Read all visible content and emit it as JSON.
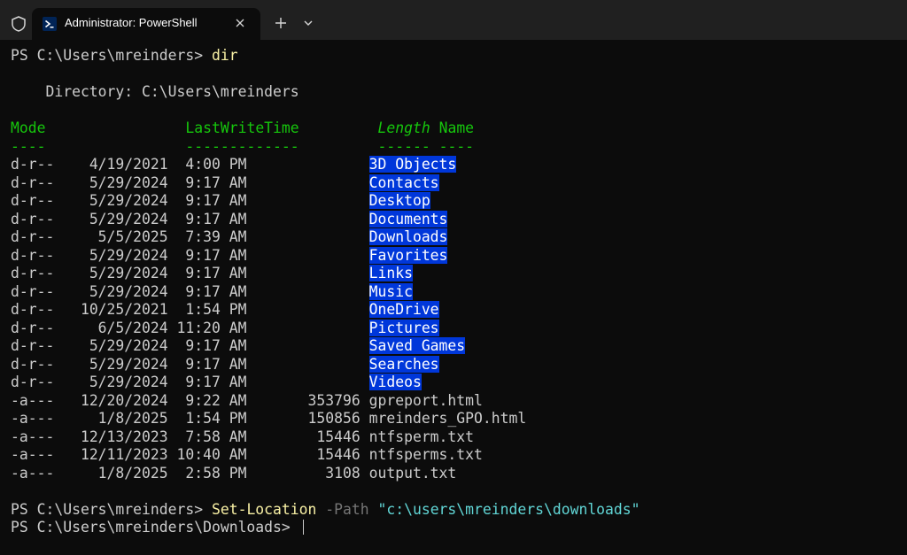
{
  "window": {
    "tab_title": "Administrator: PowerShell",
    "icons": {
      "shield": "shield-icon",
      "tab": "powershell-icon",
      "close": "close-icon",
      "new_tab": "plus-icon",
      "dropdown": "chevron-down-icon"
    },
    "colors": {
      "titlebar": "#202020",
      "background": "#0c0c0c",
      "text": "#cccccc",
      "header_green": "#16c60c",
      "command_yellow": "#f9f1a5",
      "parameter_gray": "#767676",
      "string_cyan": "#61d6d6",
      "directory_highlight": "#0037da"
    }
  },
  "terminal": {
    "prompt1": "PS C:\\Users\\mreinders> ",
    "cmd1": "dir",
    "directory_line": "    Directory: C:\\Users\\mreinders",
    "headers": {
      "mode": "Mode",
      "lastwritetime": "LastWriteTime",
      "length": "Length",
      "name": "Name"
    },
    "underlines": {
      "mode": "----",
      "lastwritetime": "-------------",
      "length": "------",
      "name": "----"
    },
    "rows": [
      {
        "mode": "d-r--",
        "time": "    4/19/2021  4:00 PM",
        "length": "",
        "name": "3D Objects",
        "dir": true
      },
      {
        "mode": "d-r--",
        "time": "    5/29/2024  9:17 AM",
        "length": "",
        "name": "Contacts",
        "dir": true
      },
      {
        "mode": "d-r--",
        "time": "    5/29/2024  9:17 AM",
        "length": "",
        "name": "Desktop",
        "dir": true
      },
      {
        "mode": "d-r--",
        "time": "    5/29/2024  9:17 AM",
        "length": "",
        "name": "Documents",
        "dir": true
      },
      {
        "mode": "d-r--",
        "time": "     5/5/2025  7:39 AM",
        "length": "",
        "name": "Downloads",
        "dir": true
      },
      {
        "mode": "d-r--",
        "time": "    5/29/2024  9:17 AM",
        "length": "",
        "name": "Favorites",
        "dir": true
      },
      {
        "mode": "d-r--",
        "time": "    5/29/2024  9:17 AM",
        "length": "",
        "name": "Links",
        "dir": true
      },
      {
        "mode": "d-r--",
        "time": "    5/29/2024  9:17 AM",
        "length": "",
        "name": "Music",
        "dir": true
      },
      {
        "mode": "d-r--",
        "time": "   10/25/2021  1:54 PM",
        "length": "",
        "name": "OneDrive",
        "dir": true
      },
      {
        "mode": "d-r--",
        "time": "     6/5/2024 11:20 AM",
        "length": "",
        "name": "Pictures",
        "dir": true
      },
      {
        "mode": "d-r--",
        "time": "    5/29/2024  9:17 AM",
        "length": "",
        "name": "Saved Games",
        "dir": true
      },
      {
        "mode": "d-r--",
        "time": "    5/29/2024  9:17 AM",
        "length": "",
        "name": "Searches",
        "dir": true
      },
      {
        "mode": "d-r--",
        "time": "    5/29/2024  9:17 AM",
        "length": "",
        "name": "Videos",
        "dir": true
      },
      {
        "mode": "-a---",
        "time": "   12/20/2024  9:22 AM",
        "length": "353796",
        "name": "gpreport.html",
        "dir": false
      },
      {
        "mode": "-a---",
        "time": "     1/8/2025  1:54 PM",
        "length": "150856",
        "name": "mreinders_GPO.html",
        "dir": false
      },
      {
        "mode": "-a---",
        "time": "   12/13/2023  7:58 AM",
        "length": " 15446",
        "name": "ntfsperm.txt",
        "dir": false
      },
      {
        "mode": "-a---",
        "time": "   12/11/2023 10:40 AM",
        "length": " 15446",
        "name": "ntfsperms.txt",
        "dir": false
      },
      {
        "mode": "-a---",
        "time": "     1/8/2025  2:58 PM",
        "length": "  3108",
        "name": "output.txt",
        "dir": false
      }
    ],
    "prompt2": "PS C:\\Users\\mreinders> ",
    "cmd2": "Set-Location",
    "param2": "-Path",
    "arg2": "\"c:\\users\\mreinders\\downloads\"",
    "prompt3": "PS C:\\Users\\mreinders\\Downloads> "
  }
}
